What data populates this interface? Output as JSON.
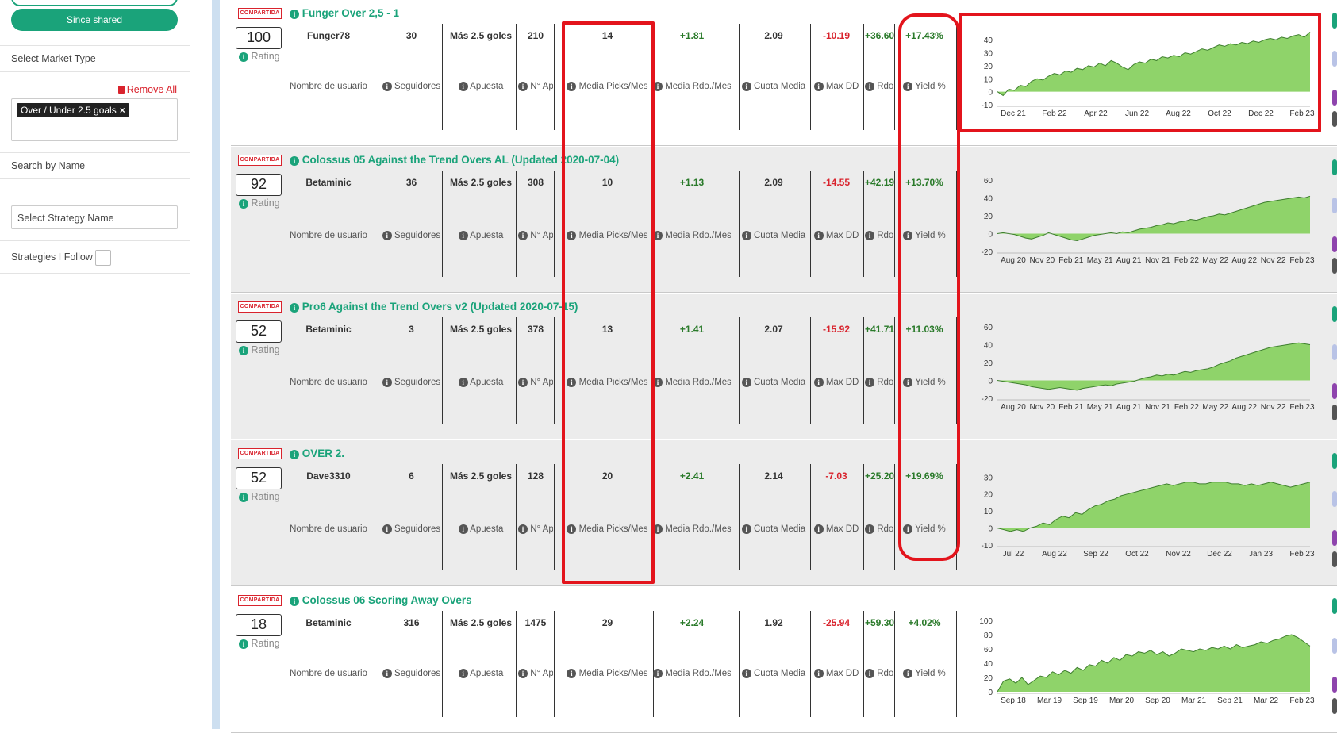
{
  "sidebar": {
    "since_shared": "Since shared",
    "market_type_label": "Select Market Type",
    "remove_all": "Remove All",
    "selected_tag": "Over / Under 2.5 goals",
    "search_label": "Search by Name",
    "strategy_placeholder": "Select Strategy Name",
    "follow_label": "Strategies I Follow"
  },
  "labels": {
    "badge": "COMPARTIDA",
    "rating": "Rating",
    "usuario": "Nombre de usuario",
    "seguidores": "Seguidores",
    "apuesta": "Apuesta",
    "n_ap": "N° Ap",
    "media_picks": "Media Picks/Mes",
    "media_rdo": "Media Rdo./Mes",
    "cuota": "Cuota Media",
    "maxdd": "Max DD",
    "rdo_short": "Rdo",
    "rdo_full": "Rdo.",
    "yield": "Yield %"
  },
  "strategies": [
    {
      "title": "Funger Over 2,5 - 1",
      "rating": "100",
      "user": "Funger78",
      "followers": "30",
      "bet": "Más 2.5 goles",
      "n_ap": "210",
      "picks": "14",
      "rdo_mes": "+1.81",
      "cuota": "2.09",
      "maxdd": "-10.19",
      "rdo": "+36.60",
      "yield": "+17.43%",
      "chart": {
        "type": "area",
        "y_ticks": [
          "40",
          "30",
          "20",
          "10",
          "0",
          "-10"
        ],
        "ylim": [
          -10,
          45
        ],
        "x_ticks": [
          "Dec 21",
          "Feb 22",
          "Apr 22",
          "Jun 22",
          "Aug 22",
          "Oct 22",
          "Dec 22",
          "Feb 23"
        ],
        "values": [
          0,
          -3,
          2,
          1,
          5,
          4,
          8,
          10,
          9,
          12,
          14,
          13,
          16,
          15,
          18,
          17,
          20,
          19,
          22,
          20,
          24,
          22,
          19,
          17,
          21,
          23,
          22,
          25,
          24,
          27,
          26,
          28,
          27,
          30,
          29,
          31,
          33,
          32,
          34,
          36,
          35,
          37,
          36,
          38,
          37,
          39,
          38,
          40,
          41,
          40,
          42,
          41,
          43,
          44,
          42,
          46
        ]
      }
    },
    {
      "title": "Colossus 05 Against the Trend Overs AL (Updated 2020-07-04)",
      "rating": "92",
      "user": "Betaminic",
      "followers": "36",
      "bet": "Más 2.5 goles",
      "n_ap": "308",
      "picks": "10",
      "rdo_mes": "+1.13",
      "cuota": "2.09",
      "maxdd": "-14.55",
      "rdo": "+42.19",
      "yield": "+13.70%",
      "chart": {
        "type": "area",
        "y_ticks": [
          "60",
          "40",
          "20",
          "0",
          "-20"
        ],
        "ylim": [
          -20,
          60
        ],
        "x_ticks": [
          "Aug 20",
          "Nov 20",
          "Feb 21",
          "May 21",
          "Aug 21",
          "Nov 21",
          "Feb 22",
          "May 22",
          "Aug 22",
          "Nov 22",
          "Feb 23"
        ],
        "values": [
          0,
          1,
          0,
          -1,
          -3,
          -5,
          -6,
          -4,
          -2,
          1,
          -1,
          -3,
          -5,
          -7,
          -8,
          -6,
          -4,
          -2,
          -1,
          0,
          1,
          0,
          2,
          1,
          3,
          5,
          6,
          7,
          9,
          10,
          12,
          11,
          13,
          14,
          16,
          15,
          17,
          19,
          20,
          22,
          21,
          23,
          25,
          27,
          29,
          31,
          33,
          35,
          36,
          37,
          38,
          39,
          40,
          41,
          40,
          42
        ]
      }
    },
    {
      "title": "Pro6 Against the Trend Overs v2 (Updated 2020-07-15)",
      "rating": "52",
      "user": "Betaminic",
      "followers": "3",
      "bet": "Más 2.5 goles",
      "n_ap": "378",
      "picks": "13",
      "rdo_mes": "+1.41",
      "cuota": "2.07",
      "maxdd": "-15.92",
      "rdo": "+41.71",
      "yield": "+11.03%",
      "chart": {
        "type": "area",
        "y_ticks": [
          "60",
          "40",
          "20",
          "0",
          "-20"
        ],
        "ylim": [
          -20,
          60
        ],
        "x_ticks": [
          "Aug 20",
          "Nov 20",
          "Feb 21",
          "May 21",
          "Aug 21",
          "Nov 21",
          "Feb 22",
          "May 22",
          "Aug 22",
          "Nov 22",
          "Feb 23"
        ],
        "values": [
          0,
          -1,
          -2,
          -3,
          -4,
          -5,
          -7,
          -8,
          -9,
          -10,
          -9,
          -8,
          -9,
          -10,
          -11,
          -9,
          -8,
          -7,
          -6,
          -5,
          -6,
          -4,
          -3,
          -2,
          -1,
          1,
          3,
          4,
          6,
          5,
          7,
          6,
          8,
          10,
          9,
          11,
          12,
          13,
          15,
          18,
          20,
          22,
          25,
          27,
          29,
          31,
          33,
          35,
          37,
          38,
          39,
          40,
          41,
          42,
          41,
          40
        ]
      }
    },
    {
      "title": "OVER 2.",
      "rating": "52",
      "user": "Dave3310",
      "followers": "6",
      "bet": "Más 2.5 goles",
      "n_ap": "128",
      "picks": "20",
      "rdo_mes": "+2.41",
      "cuota": "2.14",
      "maxdd": "-7.03",
      "rdo": "+25.20",
      "yield": "+19.69%",
      "chart": {
        "type": "area",
        "y_ticks": [
          "30",
          "20",
          "10",
          "0",
          "-10"
        ],
        "ylim": [
          -10,
          32
        ],
        "x_ticks": [
          "Jul 22",
          "Aug 22",
          "Sep 22",
          "Oct 22",
          "Nov 22",
          "Dec 22",
          "Jan 23",
          "Feb 23"
        ],
        "values": [
          0,
          -1,
          -2,
          -1,
          -2,
          0,
          1,
          3,
          2,
          5,
          7,
          6,
          9,
          8,
          11,
          13,
          14,
          16,
          17,
          19,
          20,
          21,
          22,
          23,
          24,
          25,
          26,
          25,
          26,
          27,
          27,
          26,
          26,
          27,
          27,
          27,
          26,
          26,
          25,
          26,
          25,
          26,
          27,
          26,
          25,
          24,
          25,
          26,
          27
        ]
      }
    },
    {
      "title": "Colossus 06 Scoring Away Overs",
      "rating": "18",
      "user": "Betaminic",
      "followers": "316",
      "bet": "Más 2.5 goles",
      "n_ap": "1475",
      "picks": "29",
      "rdo_mes": "+2.24",
      "cuota": "1.92",
      "maxdd": "-25.94",
      "rdo": "+59.30",
      "yield": "+4.02%",
      "chart": {
        "type": "area",
        "y_ticks": [
          "100",
          "80",
          "60",
          "40",
          "20",
          "0"
        ],
        "ylim": [
          0,
          100
        ],
        "x_ticks": [
          "Sep 18",
          "Mar 19",
          "Sep 19",
          "Mar 20",
          "Sep 20",
          "Mar 21",
          "Sep 21",
          "Mar 22",
          "Feb 23"
        ],
        "values": [
          0,
          15,
          18,
          12,
          20,
          10,
          16,
          22,
          20,
          28,
          24,
          30,
          26,
          34,
          30,
          38,
          36,
          44,
          40,
          48,
          44,
          52,
          50,
          56,
          54,
          58,
          52,
          56,
          50,
          54,
          60,
          58,
          56,
          60,
          58,
          62,
          60,
          64,
          60,
          66,
          62,
          64,
          66,
          70,
          68,
          72,
          74,
          78,
          80,
          76,
          70,
          64
        ]
      }
    }
  ]
}
